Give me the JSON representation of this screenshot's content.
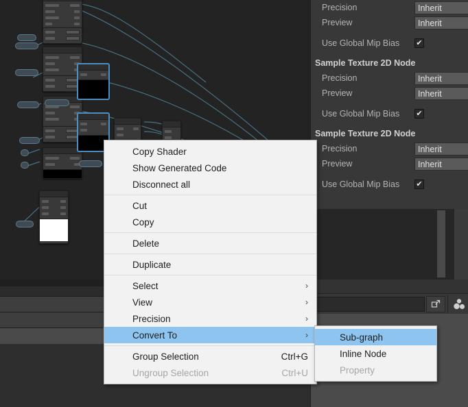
{
  "app": {
    "title": "Shader Graph",
    "accent_color": "#8ec5f0",
    "menu_bg": "#f2f2f2",
    "panel_bg": "#383838",
    "graph_bg": "#232323"
  },
  "inspector": {
    "sections": [
      {
        "heading": null,
        "rows": [
          {
            "label": "Precision",
            "type": "dropdown",
            "value": "Inherit"
          },
          {
            "label": "Preview",
            "type": "dropdown",
            "value": "Inherit"
          },
          {
            "label": "Use Global Mip Bias",
            "type": "checkbox",
            "checked": true,
            "check_glyph": "✔"
          }
        ]
      },
      {
        "heading": "Sample Texture 2D Node",
        "rows": [
          {
            "label": "Precision",
            "type": "dropdown",
            "value": "Inherit"
          },
          {
            "label": "Preview",
            "type": "dropdown",
            "value": "Inherit"
          },
          {
            "label": "Use Global Mip Bias",
            "type": "checkbox",
            "checked": true,
            "check_glyph": "✔"
          }
        ]
      },
      {
        "heading": "Sample Texture 2D Node",
        "rows": [
          {
            "label": "Precision",
            "type": "dropdown",
            "value": "Inherit"
          },
          {
            "label": "Preview",
            "type": "dropdown",
            "value": "Inherit"
          },
          {
            "label": "Use Global Mip Bias",
            "type": "checkbox",
            "checked": true,
            "check_glyph": "✔"
          }
        ]
      }
    ]
  },
  "toolbar": {
    "search_value": "",
    "expand_icon": "expand-icon"
  },
  "context_menu": {
    "groups": [
      {
        "items": [
          {
            "label": "Copy Shader",
            "accel": "",
            "arrow": "",
            "disabled": false,
            "highlighted": false
          },
          {
            "label": "Show Generated Code",
            "accel": "",
            "arrow": "",
            "disabled": false,
            "highlighted": false
          },
          {
            "label": "Disconnect all",
            "accel": "",
            "arrow": "",
            "disabled": false,
            "highlighted": false
          }
        ]
      },
      {
        "items": [
          {
            "label": "Cut",
            "accel": "",
            "arrow": "",
            "disabled": false,
            "highlighted": false
          },
          {
            "label": "Copy",
            "accel": "",
            "arrow": "",
            "disabled": false,
            "highlighted": false
          }
        ]
      },
      {
        "items": [
          {
            "label": "Delete",
            "accel": "",
            "arrow": "",
            "disabled": false,
            "highlighted": false
          }
        ]
      },
      {
        "items": [
          {
            "label": "Duplicate",
            "accel": "",
            "arrow": "",
            "disabled": false,
            "highlighted": false
          }
        ]
      },
      {
        "items": [
          {
            "label": "Select",
            "accel": "",
            "arrow": "›",
            "disabled": false,
            "highlighted": false
          },
          {
            "label": "View",
            "accel": "",
            "arrow": "›",
            "disabled": false,
            "highlighted": false
          },
          {
            "label": "Precision",
            "accel": "",
            "arrow": "›",
            "disabled": false,
            "highlighted": false
          },
          {
            "label": "Convert To",
            "accel": "",
            "arrow": "›",
            "disabled": false,
            "highlighted": true
          }
        ]
      },
      {
        "items": [
          {
            "label": "Group Selection",
            "accel": "Ctrl+G",
            "arrow": "",
            "disabled": false,
            "highlighted": false
          },
          {
            "label": "Ungroup Selection",
            "accel": "Ctrl+U",
            "arrow": "",
            "disabled": true,
            "highlighted": false
          }
        ]
      }
    ]
  },
  "submenu": {
    "parent": "Convert To",
    "items": [
      {
        "label": "Sub-graph",
        "disabled": false,
        "highlighted": true
      },
      {
        "label": "Inline Node",
        "disabled": false,
        "highlighted": false
      },
      {
        "label": "Property",
        "disabled": true,
        "highlighted": false
      }
    ]
  }
}
